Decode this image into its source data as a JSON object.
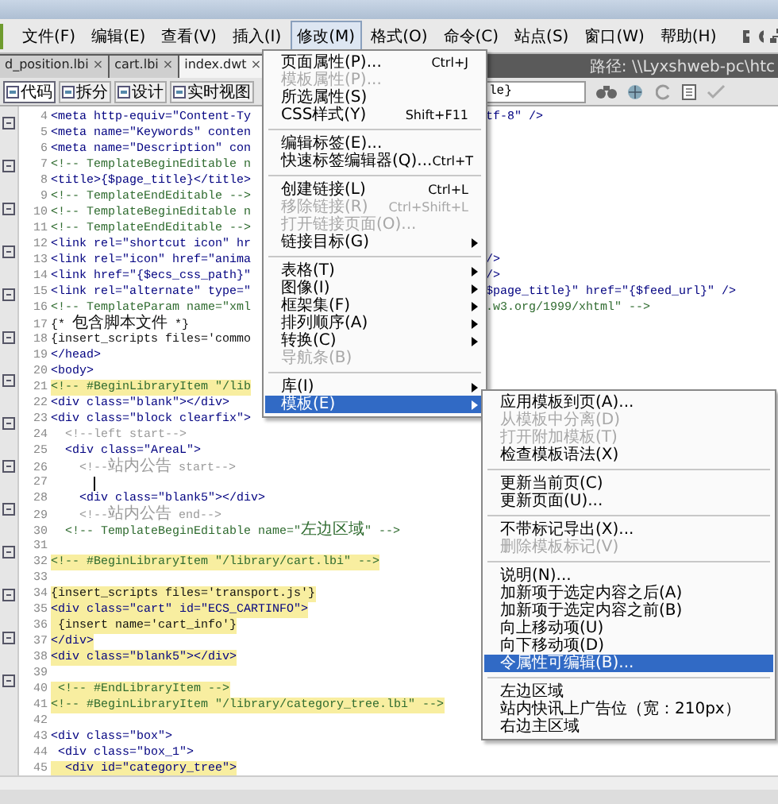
{
  "menubar": {
    "items": [
      {
        "label": "文件(F)",
        "selected": false
      },
      {
        "label": "编辑(E)",
        "selected": false
      },
      {
        "label": "查看(V)",
        "selected": false
      },
      {
        "label": "插入(I)",
        "selected": false
      },
      {
        "label": "修改(M)",
        "selected": true
      },
      {
        "label": "格式(O)",
        "selected": false
      },
      {
        "label": "命令(C)",
        "selected": false
      },
      {
        "label": "站点(S)",
        "selected": false
      },
      {
        "label": "窗口(W)",
        "selected": false
      },
      {
        "label": "帮助(H)",
        "selected": false
      }
    ]
  },
  "file_tabs": [
    {
      "label": "d_position.lbi",
      "close": "×",
      "selected": false
    },
    {
      "label": "cart.lbi",
      "close": "×",
      "selected": false
    },
    {
      "label": "index.dwt",
      "close": "×",
      "selected": true
    }
  ],
  "path": "路径: \\\\Lyxshweb-pc\\htc",
  "view_buttons": [
    {
      "label": "代码",
      "selected": true
    },
    {
      "label": "拆分",
      "selected": false
    },
    {
      "label": "设计",
      "selected": false
    },
    {
      "label": "实时视图",
      "selected": false
    }
  ],
  "title_field": {
    "value": "le}"
  },
  "code_lines": [
    {
      "number": "4",
      "kind": "tag",
      "text": "<meta http-equiv=\"Content-Ty",
      "right": "tf-8\" />",
      "highlighted": false,
      "cursor": false
    },
    {
      "number": "5",
      "kind": "tag",
      "text": "<meta name=\"Keywords\" conten",
      "highlighted": false,
      "cursor": false
    },
    {
      "number": "6",
      "kind": "tag",
      "text": "<meta name=\"Description\" con",
      "highlighted": false,
      "cursor": false
    },
    {
      "number": "7",
      "kind": "template",
      "text": "<!-- TemplateBeginEditable n",
      "highlighted": false,
      "cursor": false
    },
    {
      "number": "8",
      "kind": "tag",
      "text": "<title>{$page_title}</title>",
      "highlighted": false,
      "cursor": false
    },
    {
      "number": "9",
      "kind": "template",
      "text": "<!-- TemplateEndEditable -->",
      "highlighted": false,
      "cursor": false
    },
    {
      "number": "10",
      "kind": "template",
      "text": "<!-- TemplateBeginEditable n",
      "highlighted": false,
      "cursor": false
    },
    {
      "number": "11",
      "kind": "template",
      "text": "<!-- TemplateEndEditable -->",
      "highlighted": false,
      "cursor": false
    },
    {
      "number": "12",
      "kind": "tag",
      "text": "<link rel=\"shortcut icon\" hr",
      "highlighted": false,
      "cursor": false
    },
    {
      "number": "13",
      "kind": "tag",
      "text": "<link rel=\"icon\" href=\"anima",
      "right": "/>",
      "highlighted": false,
      "cursor": false
    },
    {
      "number": "14",
      "kind": "tag",
      "text": "<link href=\"{$ecs_css_path}\"",
      "right": "/>",
      "highlighted": false,
      "cursor": false
    },
    {
      "number": "15",
      "kind": "tag",
      "text": "<link rel=\"alternate\" type=\"",
      "right": "$page_title}\" href=\"{$feed_url}\" />",
      "highlighted": false,
      "cursor": false
    },
    {
      "number": "16",
      "kind": "template",
      "text": "<!-- TemplateParam name=\"xml",
      "right": ".w3.org/1999/xhtml\" -->",
      "highlighted": false,
      "cursor": false
    },
    {
      "number": "17",
      "kind": "text",
      "text": "{* 包含脚本文件 *}",
      "highlighted": false,
      "cursor": false
    },
    {
      "number": "18",
      "kind": "text",
      "text": "{insert_scripts files='commo",
      "highlighted": false,
      "cursor": false
    },
    {
      "number": "19",
      "kind": "tag",
      "text": "</head>",
      "highlighted": false,
      "cursor": false
    },
    {
      "number": "20",
      "kind": "tag",
      "text": "<body>",
      "highlighted": false,
      "cursor": false
    },
    {
      "number": "21",
      "kind": "template",
      "text": "<!-- #BeginLibraryItem \"/lib",
      "highlighted": true,
      "cursor": false
    },
    {
      "number": "22",
      "kind": "tag",
      "text": "<div class=\"blank\"></div>",
      "highlighted": false,
      "cursor": false
    },
    {
      "number": "23",
      "kind": "tag",
      "text": "<div class=\"block clearfix\">",
      "highlighted": false,
      "cursor": false
    },
    {
      "number": "24",
      "kind": "comment",
      "text": "  <!--left start-->",
      "highlighted": false,
      "cursor": false
    },
    {
      "number": "25",
      "kind": "tag",
      "text": "  <div class=\"AreaL\">",
      "highlighted": false,
      "cursor": false
    },
    {
      "number": "26",
      "kind": "comment",
      "text": "    <!--站内公告 start-->",
      "highlighted": false,
      "cursor": false
    },
    {
      "number": "27",
      "highlighted": false,
      "cursor": true
    },
    {
      "number": "28",
      "kind": "tag",
      "text": "    <div class=\"blank5\"></div>",
      "highlighted": false,
      "cursor": false
    },
    {
      "number": "29",
      "kind": "comment",
      "text": "    <!--站内公告 end-->",
      "highlighted": false,
      "cursor": false
    },
    {
      "number": "30",
      "kind": "template",
      "text": "  <!-- TemplateBeginEditable name=\"左边区域\" -->",
      "highlighted": false,
      "cursor": false
    },
    {
      "number": "31",
      "highlighted": false,
      "cursor": false
    },
    {
      "number": "32",
      "kind": "template",
      "text": "<!-- #BeginLibraryItem \"/library/cart.lbi\" -->",
      "highlighted": true,
      "cursor": false
    },
    {
      "number": "33",
      "highlighted": false,
      "cursor": false
    },
    {
      "number": "34",
      "kind": "text",
      "text": "{insert_scripts files='transport.js'}",
      "highlighted": true,
      "cursor": false
    },
    {
      "number": "35",
      "kind": "tag",
      "text": "<div class=\"cart\" id=\"ECS_CARTINFO\">",
      "highlighted": true,
      "cursor": false
    },
    {
      "number": "36",
      "kind": "text",
      "text": " {insert name='cart_info'}",
      "highlighted": true,
      "cursor": false
    },
    {
      "number": "37",
      "kind": "tag",
      "text": "</div>",
      "highlighted": true,
      "cursor": false
    },
    {
      "number": "38",
      "kind": "tag",
      "text": "<div class=\"blank5\"></div>",
      "highlighted": true,
      "cursor": false
    },
    {
      "number": "39",
      "highlighted": false,
      "cursor": false
    },
    {
      "number": "40",
      "kind": "template",
      "text": " <!-- #EndLibraryItem -->",
      "highlighted": true,
      "cursor": false
    },
    {
      "number": "41",
      "kind": "template",
      "text": "<!-- #BeginLibraryItem \"/library/category_tree.lbi\" -->",
      "highlighted": true,
      "cursor": false
    },
    {
      "number": "42",
      "highlighted": false,
      "cursor": false
    },
    {
      "number": "43",
      "kind": "tag",
      "text": "<div class=\"box\">",
      "highlighted": false,
      "cursor": false
    },
    {
      "number": "44",
      "kind": "tag",
      "text": " <div class=\"box_1\">",
      "highlighted": false,
      "cursor": false
    },
    {
      "number": "45",
      "kind": "tag",
      "text": "  <div id=\"category_tree\">",
      "highlighted": true,
      "cursor": false
    }
  ],
  "modify_menu": {
    "items": [
      {
        "kind": "item",
        "label": "页面属性(P)...",
        "shortcut": "Ctrl+J",
        "disabled": false,
        "submenu": false,
        "selected": false
      },
      {
        "kind": "item",
        "label": "模板属性(P)...",
        "disabled": true,
        "submenu": false,
        "selected": false
      },
      {
        "kind": "item",
        "label": "所选属性(S)",
        "disabled": false,
        "submenu": false,
        "selected": false
      },
      {
        "kind": "item",
        "label": "CSS样式(Y)",
        "shortcut": "Shift+F11",
        "disabled": false,
        "submenu": false,
        "selected": false
      },
      {
        "kind": "separator"
      },
      {
        "kind": "item",
        "label": "编辑标签(E)...",
        "disabled": false,
        "submenu": false,
        "selected": false
      },
      {
        "kind": "item",
        "label": "快速标签编辑器(Q)...",
        "shortcut": "Ctrl+T",
        "disabled": false,
        "submenu": false,
        "selected": false
      },
      {
        "kind": "separator"
      },
      {
        "kind": "item",
        "label": "创建链接(L)",
        "shortcut": "Ctrl+L",
        "disabled": false,
        "submenu": false,
        "selected": false
      },
      {
        "kind": "item",
        "label": "移除链接(R)",
        "shortcut": "Ctrl+Shift+L",
        "disabled": true,
        "submenu": false,
        "selected": false
      },
      {
        "kind": "item",
        "label": "打开链接页面(O)...",
        "disabled": true,
        "submenu": false,
        "selected": false
      },
      {
        "kind": "item",
        "label": "链接目标(G)",
        "disabled": false,
        "submenu": true,
        "selected": false
      },
      {
        "kind": "separator"
      },
      {
        "kind": "item",
        "label": "表格(T)",
        "disabled": false,
        "submenu": true,
        "selected": false
      },
      {
        "kind": "item",
        "label": "图像(I)",
        "disabled": false,
        "submenu": true,
        "selected": false
      },
      {
        "kind": "item",
        "label": "框架集(F)",
        "disabled": false,
        "submenu": true,
        "selected": false
      },
      {
        "kind": "item",
        "label": "排列顺序(A)",
        "disabled": false,
        "submenu": true,
        "selected": false
      },
      {
        "kind": "item",
        "label": "转换(C)",
        "disabled": false,
        "submenu": true,
        "selected": false
      },
      {
        "kind": "item",
        "label": "导航条(B)",
        "disabled": true,
        "submenu": false,
        "selected": false
      },
      {
        "kind": "separator"
      },
      {
        "kind": "item",
        "label": "库(I)",
        "disabled": false,
        "submenu": true,
        "selected": false
      },
      {
        "kind": "item",
        "label": "模板(E)",
        "disabled": false,
        "submenu": true,
        "selected": true
      }
    ]
  },
  "template_submenu": {
    "items": [
      {
        "kind": "item",
        "label": "应用模板到页(A)...",
        "disabled": false,
        "selected": false
      },
      {
        "kind": "item",
        "label": "从模板中分离(D)",
        "disabled": true,
        "selected": false
      },
      {
        "kind": "item",
        "label": "打开附加模板(T)",
        "disabled": true,
        "selected": false
      },
      {
        "kind": "item",
        "label": "检查模板语法(X)",
        "disabled": false,
        "selected": false
      },
      {
        "kind": "separator"
      },
      {
        "kind": "item",
        "label": "更新当前页(C)",
        "disabled": false,
        "selected": false
      },
      {
        "kind": "item",
        "label": "更新页面(U)...",
        "disabled": false,
        "selected": false
      },
      {
        "kind": "separator"
      },
      {
        "kind": "item",
        "label": "不带标记导出(X)...",
        "disabled": false,
        "selected": false
      },
      {
        "kind": "item",
        "label": "删除模板标记(V)",
        "disabled": true,
        "selected": false
      },
      {
        "kind": "separator"
      },
      {
        "kind": "item",
        "label": "说明(N)...",
        "disabled": false,
        "selected": false
      },
      {
        "kind": "item",
        "label": "加新项于选定内容之后(A)",
        "disabled": false,
        "selected": false
      },
      {
        "kind": "item",
        "label": "加新项于选定内容之前(B)",
        "disabled": false,
        "selected": false
      },
      {
        "kind": "item",
        "label": "向上移动项(U)",
        "disabled": false,
        "selected": false
      },
      {
        "kind": "item",
        "label": "向下移动项(D)",
        "disabled": false,
        "selected": false
      },
      {
        "kind": "item",
        "label": "令属性可编辑(B)...",
        "disabled": false,
        "selected": true
      },
      {
        "kind": "separator"
      },
      {
        "kind": "item",
        "label": "左边区域",
        "disabled": false,
        "selected": false
      },
      {
        "kind": "item",
        "label": "站内快讯上广告位（宽：210px）",
        "disabled": false,
        "selected": false
      },
      {
        "kind": "item",
        "label": "右边主区域",
        "disabled": false,
        "selected": false
      }
    ]
  }
}
